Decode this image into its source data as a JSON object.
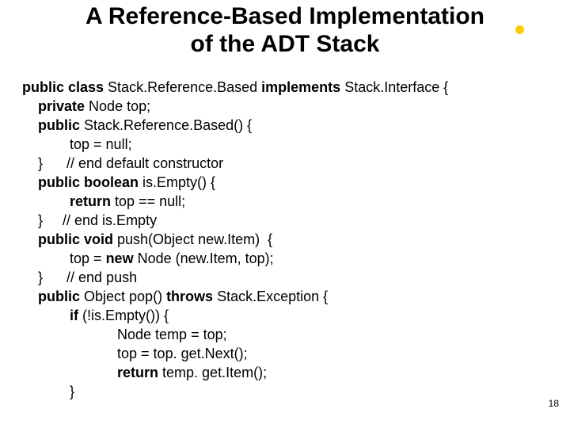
{
  "title_line1": "A Reference-Based Implementation",
  "title_line2": "of the ADT Stack",
  "code": {
    "l1a": "public class ",
    "l1b": "Stack.Reference.Based ",
    "l1c": "implements ",
    "l1d": "Stack.Interface {",
    "l2a": "    private ",
    "l2b": "Node top;",
    "l3a": "    public ",
    "l3b": "Stack.Reference.Based() {",
    "l4": "            top = null;",
    "l5": "    }      // end default constructor",
    "l6a": "    public boolean ",
    "l6b": "is.Empty() {",
    "l7a": "            return ",
    "l7b": "top == null;",
    "l8": "    }     // end is.Empty",
    "l9a": "    public void ",
    "l9b": "push(Object new.Item)  {",
    "l10a": "            top = ",
    "l10b": "new ",
    "l10c": "Node (new.Item, top);",
    "l11": "    }      // end push",
    "l12a": "    public ",
    "l12b": "Object pop() ",
    "l12c": "throws ",
    "l12d": "Stack.Exception {",
    "l13a": "            if ",
    "l13b": "(!is.Empty()) {",
    "l14": "                        Node temp = top;",
    "l15": "                        top = top. get.Next();",
    "l16a": "                        return ",
    "l16b": "temp. get.Item();",
    "l17": "            }"
  },
  "page_number": "18"
}
